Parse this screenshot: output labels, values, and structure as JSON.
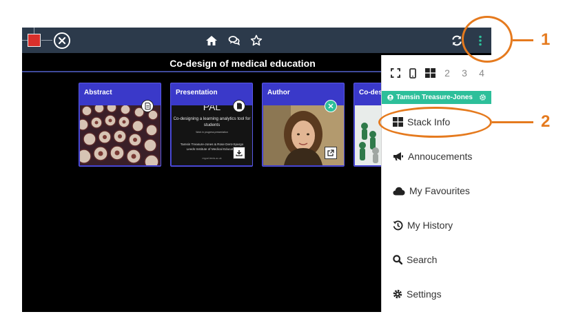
{
  "stack": {
    "title": "Co-design of medical education"
  },
  "cards": [
    {
      "label": "Abstract"
    },
    {
      "label": "Presentation",
      "slide": {
        "logo": "PAL",
        "title": "Co-designing a learning analytics tool for students",
        "subtitle": "Work in progress presentation",
        "authors": "Tamsin Treasure-Jones & Rose Dent-Spargo",
        "institute": "Leeds Institute of Medical Education",
        "url": "mypal.leeds.ac.uk"
      }
    },
    {
      "label": "Author"
    },
    {
      "label": "Co-des"
    }
  ],
  "menu": {
    "view_options": [
      "2",
      "3",
      "4"
    ],
    "user_name": "Tamsin Treasure-Jones",
    "items": [
      {
        "label": "Stack Info",
        "icon": "th-large-icon"
      },
      {
        "label": "Annoucements",
        "icon": "megaphone-icon"
      },
      {
        "label": "My Favourites",
        "icon": "cloud-icon"
      },
      {
        "label": "My History",
        "icon": "history-icon"
      },
      {
        "label": "Search",
        "icon": "search-icon"
      },
      {
        "label": "Settings",
        "icon": "gear-icon"
      }
    ]
  },
  "callouts": {
    "one": "1",
    "two": "2"
  },
  "colors": {
    "topbar": "#2c3a4b",
    "card": "#3a39c9",
    "user_bar": "#2dbf9a",
    "callout": "#e57a1e",
    "logo": "#d9302b"
  }
}
